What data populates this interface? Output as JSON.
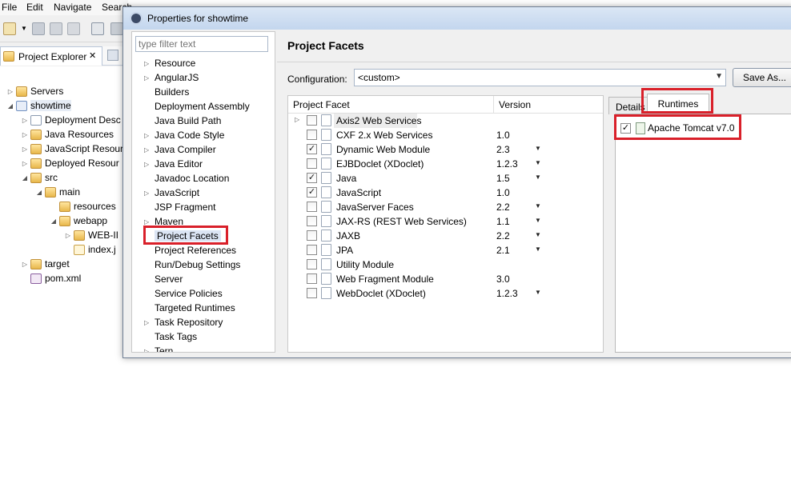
{
  "eclipse": {
    "menu": [
      "File",
      "Edit",
      "Navigate",
      "Search"
    ],
    "explorer_tab": "Project Explorer",
    "tree": [
      {
        "label": "Servers",
        "arrow": "▷"
      },
      {
        "label": "showtime",
        "arrow": "◢"
      },
      {
        "label": "Deployment Desc",
        "arrow": "▷"
      },
      {
        "label": "Java Resources",
        "arrow": "▷"
      },
      {
        "label": "JavaScript Resour",
        "arrow": "▷"
      },
      {
        "label": "Deployed Resour",
        "arrow": "▷"
      },
      {
        "label": "src",
        "arrow": "◢"
      },
      {
        "label": "main",
        "arrow": "◢"
      },
      {
        "label": "resources",
        "arrow": ""
      },
      {
        "label": "webapp",
        "arrow": "◢"
      },
      {
        "label": "WEB-II",
        "arrow": "▷"
      },
      {
        "label": "index.j",
        "arrow": ""
      },
      {
        "label": "target",
        "arrow": "▷"
      },
      {
        "label": "pom.xml",
        "arrow": ""
      }
    ]
  },
  "dialog": {
    "title": "Properties for showtime",
    "filter_placeholder": "type filter text",
    "nav": [
      {
        "label": "Resource",
        "arrow": "▷"
      },
      {
        "label": "AngularJS",
        "arrow": "▷"
      },
      {
        "label": "Builders",
        "arrow": ""
      },
      {
        "label": "Deployment Assembly",
        "arrow": ""
      },
      {
        "label": "Java Build Path",
        "arrow": ""
      },
      {
        "label": "Java Code Style",
        "arrow": "▷"
      },
      {
        "label": "Java Compiler",
        "arrow": "▷"
      },
      {
        "label": "Java Editor",
        "arrow": "▷"
      },
      {
        "label": "Javadoc Location",
        "arrow": ""
      },
      {
        "label": "JavaScript",
        "arrow": "▷"
      },
      {
        "label": "JSP Fragment",
        "arrow": ""
      },
      {
        "label": "Maven",
        "arrow": "▷"
      },
      {
        "label": "Project Facets",
        "arrow": ""
      },
      {
        "label": "Project References",
        "arrow": ""
      },
      {
        "label": "Run/Debug Settings",
        "arrow": ""
      },
      {
        "label": "Server",
        "arrow": ""
      },
      {
        "label": "Service Policies",
        "arrow": ""
      },
      {
        "label": "Targeted Runtimes",
        "arrow": ""
      },
      {
        "label": "Task Repository",
        "arrow": "▷"
      },
      {
        "label": "Task Tags",
        "arrow": ""
      },
      {
        "label": "Tern",
        "arrow": "▷"
      }
    ],
    "page_title": "Project Facets",
    "configuration_label": "Configuration:",
    "configuration_value": "<custom>",
    "save_as": "Save As...",
    "table_headers": {
      "facet": "Project Facet",
      "version": "Version"
    },
    "facets": [
      {
        "name": "Axis2 Web Services",
        "version": "",
        "checked": false,
        "dropdown": false,
        "expandable": true
      },
      {
        "name": "CXF 2.x Web Services",
        "version": "1.0",
        "checked": false,
        "dropdown": false,
        "expandable": false
      },
      {
        "name": "Dynamic Web Module",
        "version": "2.3",
        "checked": true,
        "dropdown": true,
        "expandable": false
      },
      {
        "name": "EJBDoclet (XDoclet)",
        "version": "1.2.3",
        "checked": false,
        "dropdown": true,
        "expandable": false
      },
      {
        "name": "Java",
        "version": "1.5",
        "checked": true,
        "dropdown": true,
        "expandable": false
      },
      {
        "name": "JavaScript",
        "version": "1.0",
        "checked": true,
        "dropdown": false,
        "expandable": false
      },
      {
        "name": "JavaServer Faces",
        "version": "2.2",
        "checked": false,
        "dropdown": true,
        "expandable": false
      },
      {
        "name": "JAX-RS (REST Web Services)",
        "version": "1.1",
        "checked": false,
        "dropdown": true,
        "expandable": false
      },
      {
        "name": "JAXB",
        "version": "2.2",
        "checked": false,
        "dropdown": true,
        "expandable": false
      },
      {
        "name": "JPA",
        "version": "2.1",
        "checked": false,
        "dropdown": true,
        "expandable": false
      },
      {
        "name": "Utility Module",
        "version": "",
        "checked": false,
        "dropdown": false,
        "expandable": false
      },
      {
        "name": "Web Fragment Module",
        "version": "3.0",
        "checked": false,
        "dropdown": false,
        "expandable": false
      },
      {
        "name": "WebDoclet (XDoclet)",
        "version": "1.2.3",
        "checked": false,
        "dropdown": true,
        "expandable": false
      }
    ],
    "tabs": {
      "details": "Details",
      "runtimes": "Runtimes"
    },
    "runtime": {
      "label": "Apache Tomcat v7.0",
      "checked": true
    }
  },
  "glyphs": {
    "check": "✓",
    "dropdown": "▼",
    "expand": "▷"
  },
  "colors": {
    "highlight_red": "#d9202a",
    "selection": "#dbe5f4"
  }
}
